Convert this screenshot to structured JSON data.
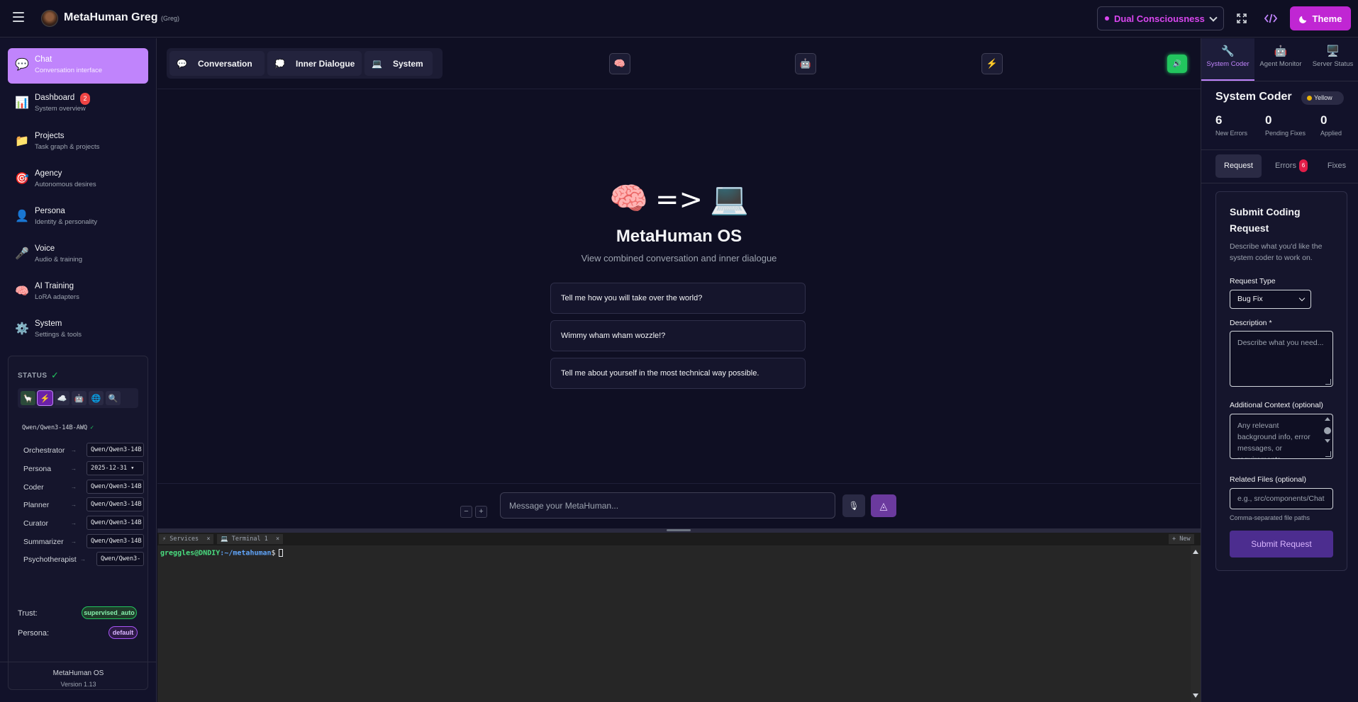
{
  "header": {
    "title": "MetaHuman Greg",
    "subtitle": "(Greg)",
    "mode_label": "Dual Consciousness",
    "theme_label": "Theme"
  },
  "sidebar": {
    "items": [
      {
        "label": "Chat",
        "sub": "Conversation interface",
        "icon": "💬"
      },
      {
        "label": "Dashboard",
        "sub": "System overview",
        "icon": "📊",
        "badge": "2"
      },
      {
        "label": "Projects",
        "sub": "Task graph & projects",
        "icon": "📁"
      },
      {
        "label": "Agency",
        "sub": "Autonomous desires",
        "icon": "🎯"
      },
      {
        "label": "Persona",
        "sub": "Identity & personality",
        "icon": "👤"
      },
      {
        "label": "Voice",
        "sub": "Audio & training",
        "icon": "🎤"
      },
      {
        "label": "AI Training",
        "sub": "LoRA adapters",
        "icon": "🧠"
      },
      {
        "label": "System",
        "sub": "Settings & tools",
        "icon": "⚙️"
      }
    ],
    "status": {
      "label": "STATUS",
      "check": "✓",
      "services": [
        "🦙",
        "⚡",
        "☁️",
        "🤖",
        "🌐",
        "🔍"
      ],
      "model": "Qwen/Qwen3-14B-AWQ",
      "model_ok": "✓",
      "roles": [
        {
          "name": "Orchestrator",
          "value": "Qwen/Qwen3-14B"
        },
        {
          "name": "Persona",
          "value": "2025-12-31 ▾"
        },
        {
          "name": "Coder",
          "value": "Qwen/Qwen3-14B"
        },
        {
          "name": "Planner",
          "value": "Qwen/Qwen3-14B"
        },
        {
          "name": "Curator",
          "value": "Qwen/Qwen3-14B"
        },
        {
          "name": "Summarizer",
          "value": "Qwen/Qwen3-14B"
        },
        {
          "name": "Psychotherapist",
          "value": "Qwen/Qwen3-"
        }
      ],
      "arrow": "→",
      "trust_label": "Trust:",
      "trust_value": "supervised_auto",
      "persona_label": "Persona:",
      "persona_value": "default"
    },
    "footer_title": "MetaHuman OS",
    "footer_version": "Version 1.13"
  },
  "main": {
    "tabs": [
      {
        "label": "Conversation",
        "icon": "💬"
      },
      {
        "label": "Inner Dialogue",
        "icon": "💭"
      },
      {
        "label": "System",
        "icon": "💻"
      }
    ],
    "toolbar_icons": [
      "🧠",
      "🤖",
      "⚡"
    ],
    "speaker_icon": "🔊",
    "hero_left": "🧠",
    "hero_arrow": "=>",
    "hero_right": "💻",
    "hero_title": "MetaHuman OS",
    "hero_subtitle": "View combined conversation and inner dialogue",
    "suggestions": [
      "Tell me how you will take over the world?",
      "Wimmy wham wham wozzle!?",
      "Tell me about yourself in the most technical way possible."
    ],
    "zoom_out": "−",
    "zoom_in": "+",
    "message_placeholder": "Message your MetaHuman...",
    "mic_icon": "🎙",
    "send_icon": "◬"
  },
  "terminal": {
    "tabs": [
      {
        "label": "⚡ Services",
        "close": "×"
      },
      {
        "label": "💻 Terminal 1",
        "close": "×"
      }
    ],
    "new_label": "+ New",
    "user": "greggles@DNDIY",
    "path": ":~/metahuman",
    "dollar": "$"
  },
  "right_panel": {
    "tabs": [
      {
        "label": "System Coder",
        "icon": "🔧"
      },
      {
        "label": "Agent Monitor",
        "icon": "🤖"
      },
      {
        "label": "Server Status",
        "icon": "🖥️"
      }
    ],
    "title": "System Coder",
    "status_badge": "Yellow",
    "stats": [
      {
        "value": "6",
        "label": "New Errors"
      },
      {
        "value": "0",
        "label": "Pending Fixes"
      },
      {
        "value": "0",
        "label": "Applied"
      }
    ],
    "subtabs": [
      {
        "label": "Request"
      },
      {
        "label": "Errors",
        "badge": "6"
      },
      {
        "label": "Fixes"
      }
    ],
    "form": {
      "title": "Submit Coding Request",
      "description": "Describe what you'd like the system coder to work on.",
      "request_type_label": "Request Type",
      "request_type_value": "Bug Fix",
      "description_label": "Description *",
      "description_placeholder": "Describe what you need...",
      "context_label": "Additional Context (optional)",
      "context_placeholder": "Any relevant background info, error messages, or requirements...",
      "files_label": "Related Files (optional)",
      "files_placeholder": "e.g., src/components/Chat",
      "files_hint": "Comma-separated file paths",
      "submit_label": "Submit Request"
    }
  }
}
